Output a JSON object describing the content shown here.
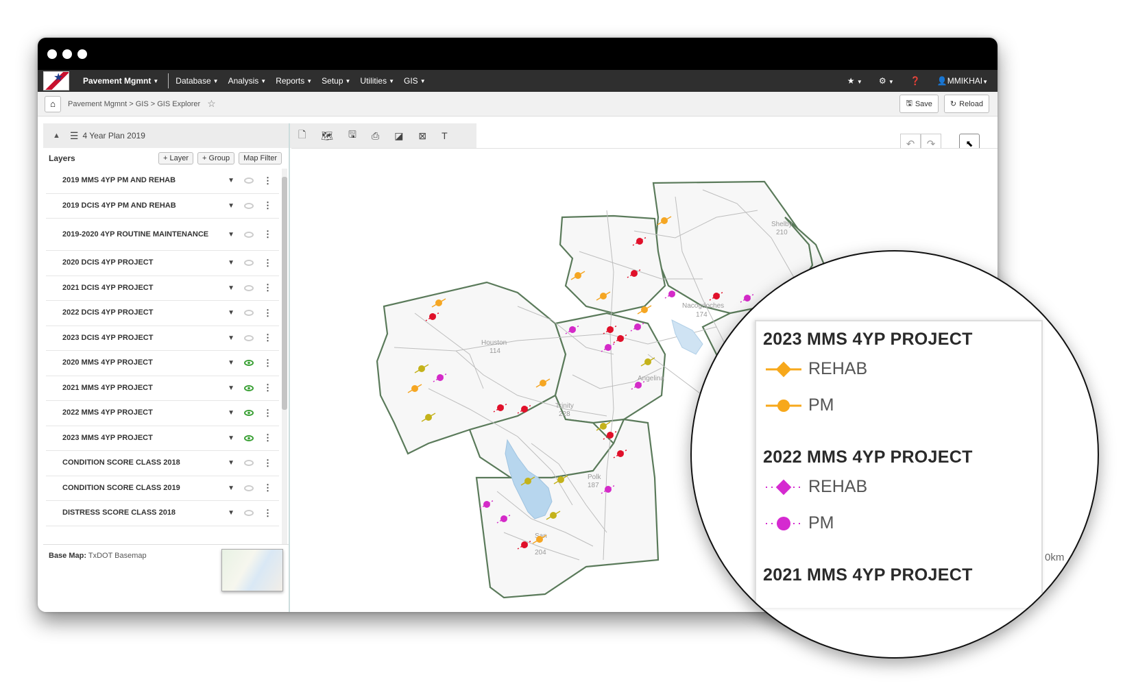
{
  "navbar": {
    "brand": "Pavement Mgmnt",
    "menus": [
      "Database",
      "Analysis",
      "Reports",
      "Setup",
      "Utilities",
      "GIS"
    ],
    "user": "MMIKHAI"
  },
  "breadcrumb": {
    "path": "Pavement Mgmnt > GIS > GIS Explorer",
    "save_label": "Save",
    "reload_label": "Reload"
  },
  "panel": {
    "title": "4 Year Plan 2019",
    "layers_label": "Layers",
    "add_layer_label": "+ Layer",
    "add_group_label": "+ Group",
    "map_filter_label": "Map Filter",
    "layers": [
      {
        "name": "2019 MMS 4YP PM AND REHAB",
        "visible": false
      },
      {
        "name": "2019 DCIS 4YP PM AND REHAB",
        "visible": false
      },
      {
        "name": "2019-2020 4YP ROUTINE MAINTENANCE",
        "visible": false
      },
      {
        "name": "2020 DCIS 4YP PROJECT",
        "visible": false
      },
      {
        "name": "2021 DCIS 4YP PROJECT",
        "visible": false
      },
      {
        "name": "2022 DCIS 4YP PROJECT",
        "visible": false
      },
      {
        "name": "2023 DCIS 4YP PROJECT",
        "visible": false
      },
      {
        "name": "2020 MMS 4YP PROJECT",
        "visible": true
      },
      {
        "name": "2021 MMS 4YP PROJECT",
        "visible": true
      },
      {
        "name": "2022 MMS 4YP PROJECT",
        "visible": true
      },
      {
        "name": "2023 MMS 4YP PROJECT",
        "visible": true
      },
      {
        "name": "CONDITION SCORE CLASS 2018",
        "visible": false
      },
      {
        "name": "CONDITION SCORE CLASS 2019",
        "visible": false
      },
      {
        "name": "DISTRESS SCORE CLASS 2018",
        "visible": false
      }
    ],
    "basemap_label": "Base Map:",
    "basemap_value": "TxDOT Basemap"
  },
  "map": {
    "places": [
      {
        "name": "Shelby",
        "code": "210"
      },
      {
        "name": "Nacogdoches",
        "code": "174"
      },
      {
        "name": "Houston",
        "code": "114"
      },
      {
        "name": "Angelina",
        "code": ""
      },
      {
        "name": "Trinity",
        "code": "228"
      },
      {
        "name": "Polk",
        "code": "187"
      },
      {
        "name": "San",
        "code": "204"
      }
    ],
    "colors": {
      "orange": "#f5a623",
      "red": "#e0102a",
      "magenta": "#d42ac8",
      "olive": "#c4b21a"
    }
  },
  "legend": {
    "sections": [
      {
        "title": "2023 MMS 4YP PROJECT",
        "items": [
          "REHAB",
          "PM"
        ],
        "color": "#f7a81b"
      },
      {
        "title": "2022 MMS 4YP PROJECT",
        "items": [
          "REHAB",
          "PM"
        ],
        "color": "#d52ad0"
      },
      {
        "title": "2021 MMS 4YP PROJECT",
        "items": [],
        "color": ""
      }
    ],
    "scale_fragment": "0km"
  }
}
